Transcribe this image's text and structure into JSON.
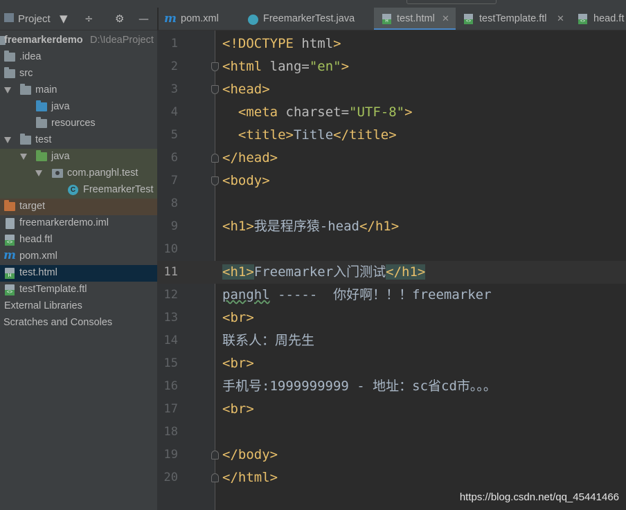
{
  "project_panel": {
    "title": "Project",
    "tree": [
      {
        "label": "freemarkerdemo",
        "path": "D:\\IdeaProject",
        "icon": "folder-icon"
      },
      {
        "label": ".idea",
        "icon": "folder-icon"
      },
      {
        "label": "src",
        "icon": "folder-icon"
      },
      {
        "label": "main",
        "icon": "folder-icon"
      },
      {
        "label": "java",
        "icon": "source-folder-icon"
      },
      {
        "label": "resources",
        "icon": "resources-folder-icon"
      },
      {
        "label": "test",
        "icon": "folder-icon"
      },
      {
        "label": "java",
        "icon": "test-source-folder-icon"
      },
      {
        "label": "com.panghl.test",
        "icon": "package-icon"
      },
      {
        "label": "FreemarkerTest",
        "icon": "java-class-icon"
      },
      {
        "label": "target",
        "icon": "excluded-folder-icon"
      },
      {
        "label": "freemarkerdemo.iml",
        "icon": "iml-file-icon"
      },
      {
        "label": "head.ftl",
        "icon": "ftl-file-icon"
      },
      {
        "label": "pom.xml",
        "icon": "maven-icon"
      },
      {
        "label": "test.html",
        "icon": "html-file-icon"
      },
      {
        "label": "testTemplate.ftl",
        "icon": "ftl-file-icon"
      },
      {
        "label": "External Libraries"
      },
      {
        "label": "Scratches and Consoles"
      }
    ]
  },
  "tabs": [
    {
      "label": "pom.xml",
      "icon": "maven-icon"
    },
    {
      "label": "FreemarkerTest.java",
      "icon": "java-class-icon"
    },
    {
      "label": "test.html",
      "icon": "html-file-icon",
      "active": true
    },
    {
      "label": "testTemplate.ftl",
      "icon": "ftl-file-icon"
    },
    {
      "label": "head.ft",
      "icon": "ftl-file-icon"
    }
  ],
  "editor": {
    "current_line": 11,
    "lines": [
      {
        "n": "1",
        "segs": [
          [
            "tg",
            "<!DOCTYPE"
          ],
          [
            "tx",
            " "
          ],
          [
            "at",
            "html"
          ],
          [
            "tg",
            ">"
          ]
        ]
      },
      {
        "n": "2",
        "segs": [
          [
            "tg",
            "<html "
          ],
          [
            "at",
            "lang="
          ],
          [
            "av",
            "\"en\""
          ],
          [
            "tg",
            ">"
          ]
        ]
      },
      {
        "n": "3",
        "segs": [
          [
            "tg",
            "<head>"
          ]
        ]
      },
      {
        "n": "4",
        "segs": [
          [
            "tx",
            "  "
          ],
          [
            "tg",
            "<meta "
          ],
          [
            "at",
            "charset="
          ],
          [
            "av",
            "\"UTF-8\""
          ],
          [
            "tg",
            ">"
          ]
        ]
      },
      {
        "n": "5",
        "segs": [
          [
            "tx",
            "  "
          ],
          [
            "tg",
            "<title>"
          ],
          [
            "tx",
            "Title"
          ],
          [
            "tg",
            "</title>"
          ]
        ]
      },
      {
        "n": "6",
        "segs": [
          [
            "tg",
            "</head>"
          ]
        ]
      },
      {
        "n": "7",
        "segs": [
          [
            "tg",
            "<body>"
          ]
        ]
      },
      {
        "n": "8",
        "segs": []
      },
      {
        "n": "9",
        "segs": [
          [
            "tg",
            "<h1>"
          ],
          [
            "tx",
            "我是程序猿-head"
          ],
          [
            "tg",
            "</h1>"
          ]
        ]
      },
      {
        "n": "10",
        "segs": []
      },
      {
        "n": "11",
        "segs": [
          [
            "tg hl",
            "<h1>"
          ],
          [
            "tx",
            "Freemarker入门测试"
          ],
          [
            "tg hl",
            "</h1>"
          ]
        ]
      },
      {
        "n": "12",
        "segs": [
          [
            "tx typo",
            "panghl"
          ],
          [
            "tx",
            " -----  你好啊！！！freemarker"
          ]
        ]
      },
      {
        "n": "13",
        "segs": [
          [
            "tg",
            "<br>"
          ]
        ]
      },
      {
        "n": "14",
        "segs": [
          [
            "tx",
            "联系人：周先生"
          ]
        ]
      },
      {
        "n": "15",
        "segs": [
          [
            "tg",
            "<br>"
          ]
        ]
      },
      {
        "n": "16",
        "segs": [
          [
            "tx",
            "手机号:1999999999 - 地址：sc省cd市。。。"
          ]
        ]
      },
      {
        "n": "17",
        "segs": [
          [
            "tg",
            "<br>"
          ]
        ]
      },
      {
        "n": "18",
        "segs": []
      },
      {
        "n": "19",
        "segs": [
          [
            "tg",
            "</body>"
          ]
        ]
      },
      {
        "n": "20",
        "segs": [
          [
            "tg",
            "</html>"
          ]
        ]
      }
    ]
  },
  "watermark": "https://blog.csdn.net/qq_45441466"
}
